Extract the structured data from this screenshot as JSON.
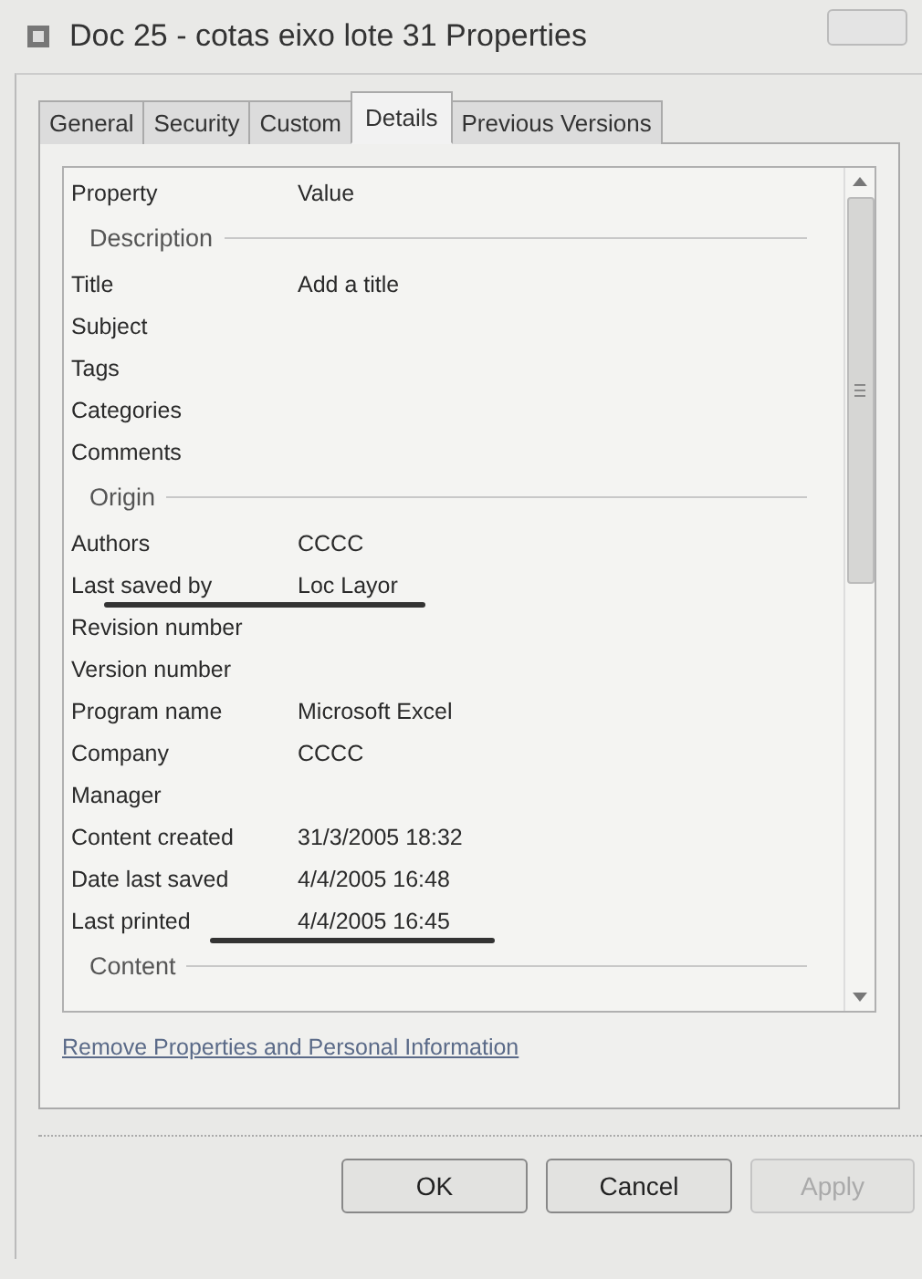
{
  "window": {
    "title": "Doc 25 - cotas eixo lote 31 Properties"
  },
  "tabs": [
    {
      "label": "General",
      "selected": false
    },
    {
      "label": "Security",
      "selected": false
    },
    {
      "label": "Custom",
      "selected": false
    },
    {
      "label": "Details",
      "selected": true
    },
    {
      "label": "Previous Versions",
      "selected": false
    }
  ],
  "table": {
    "columns": [
      "Property",
      "Value"
    ],
    "rows": [
      {
        "kind": "header",
        "label": "Description"
      },
      {
        "kind": "property",
        "label": "Title",
        "value": "Add a title",
        "marked": false
      },
      {
        "kind": "property",
        "label": "Subject",
        "marked": false
      },
      {
        "kind": "property",
        "label": "Tags",
        "marked": false
      },
      {
        "kind": "property",
        "label": "Categories",
        "marked": false
      },
      {
        "kind": "property",
        "label": "Comments",
        "marked": false
      },
      {
        "kind": "header",
        "label": "Origin"
      },
      {
        "kind": "property",
        "label": "Authors",
        "value": "CCCC",
        "marked": false
      },
      {
        "kind": "property",
        "label": "Last saved by",
        "value": "Loc Layor",
        "marked": true
      },
      {
        "kind": "property",
        "label": "Revision number",
        "marked": false
      },
      {
        "kind": "property",
        "label": "Version number",
        "marked": false
      },
      {
        "kind": "property",
        "label": "Program name",
        "value": "Microsoft Excel",
        "marked": false
      },
      {
        "kind": "property",
        "label": "Company",
        "value": "CCCC",
        "marked": false
      },
      {
        "kind": "property",
        "label": "Manager",
        "marked": false
      },
      {
        "kind": "property",
        "label": "Content created",
        "value": "31/3/2005 18:32",
        "marked": false
      },
      {
        "kind": "property",
        "label": "Date last saved",
        "value": "4/4/2005 16:48",
        "marked": false
      },
      {
        "kind": "property",
        "label": "Last printed",
        "value": "4/4/2005 16:45",
        "marked": true
      },
      {
        "kind": "header",
        "label": "Content"
      }
    ]
  },
  "link": "Remove Properties and Personal Information",
  "buttons": [
    {
      "label": "OK",
      "disabled": false
    },
    {
      "label": "Cancel",
      "disabled": false
    },
    {
      "label": "Apply",
      "disabled": true
    }
  ]
}
